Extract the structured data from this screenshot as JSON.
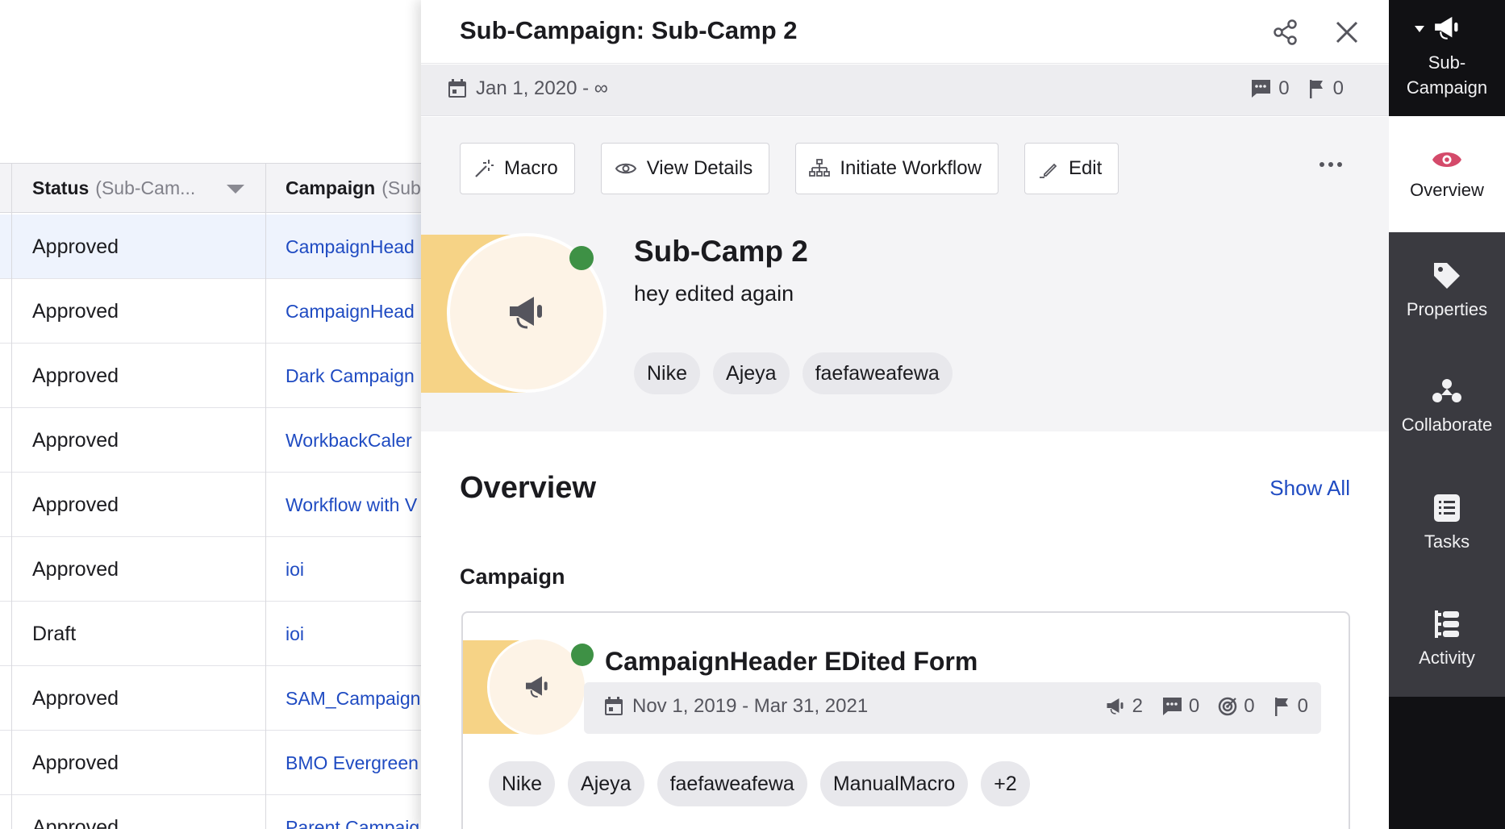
{
  "table": {
    "headers": {
      "status_label": "Status",
      "status_sub": "(Sub-Cam...",
      "campaign_label": "Campaign",
      "campaign_sub": "(Sub"
    },
    "rows": [
      {
        "status": "Approved",
        "campaign": "CampaignHead"
      },
      {
        "status": "Approved",
        "campaign": "CampaignHead"
      },
      {
        "status": "Approved",
        "campaign": "Dark Campaign"
      },
      {
        "status": "Approved",
        "campaign": "WorkbackCaler"
      },
      {
        "status": "Approved",
        "campaign": "Workflow with V"
      },
      {
        "status": "Approved",
        "campaign": "ioi"
      },
      {
        "status": "Draft",
        "campaign": "ioi"
      },
      {
        "status": "Approved",
        "campaign": "SAM_Campaign"
      },
      {
        "status": "Approved",
        "campaign": "BMO Evergreen"
      },
      {
        "status": "Approved",
        "campaign": "Parent Campaig"
      }
    ]
  },
  "panel": {
    "title": "Sub-Campaign: Sub-Camp 2",
    "date_range": "Jan 1, 2020 - ∞",
    "comments_count": "0",
    "flags_count": "0",
    "actions": {
      "macro": "Macro",
      "view_details": "View Details",
      "initiate_workflow": "Initiate Workflow",
      "edit": "Edit"
    },
    "hero": {
      "name": "Sub-Camp 2",
      "description": "hey edited again",
      "tags": [
        "Nike",
        "Ajeya",
        "faefaweafewa"
      ]
    },
    "overview": {
      "title": "Overview",
      "show_all": "Show All",
      "campaign_section": "Campaign"
    },
    "campaign_card": {
      "name": "CampaignHeader EDited Form",
      "date_range": "Nov 1, 2019 - Mar 31, 2021",
      "subcampaigns_count": "2",
      "comments_count": "0",
      "goals_count": "0",
      "flags_count": "0",
      "tags": [
        "Nike",
        "Ajeya",
        "faefaweafewa",
        "ManualMacro",
        "+2"
      ]
    }
  },
  "nav": {
    "sub_campaign_line1": "Sub-",
    "sub_campaign_line2": "Campaign",
    "overview": "Overview",
    "properties": "Properties",
    "collaborate": "Collaborate",
    "tasks": "Tasks",
    "activity": "Activity"
  },
  "colors": {
    "link": "#1f4bc2",
    "status_dot": "#3e9145",
    "avatar_band": "#f6d386",
    "nav_bg": "#3a3a40",
    "overview_eye": "#d44a6a"
  },
  "icons": [
    "share-icon",
    "close-icon",
    "calendar-icon",
    "comment-icon",
    "flag-icon",
    "magic-wand-icon",
    "eye-icon",
    "workflow-icon",
    "pencil-icon",
    "more-icon",
    "megaphone-icon",
    "target-icon",
    "tag-icon",
    "collaborate-icon",
    "tasks-icon",
    "activity-icon"
  ]
}
